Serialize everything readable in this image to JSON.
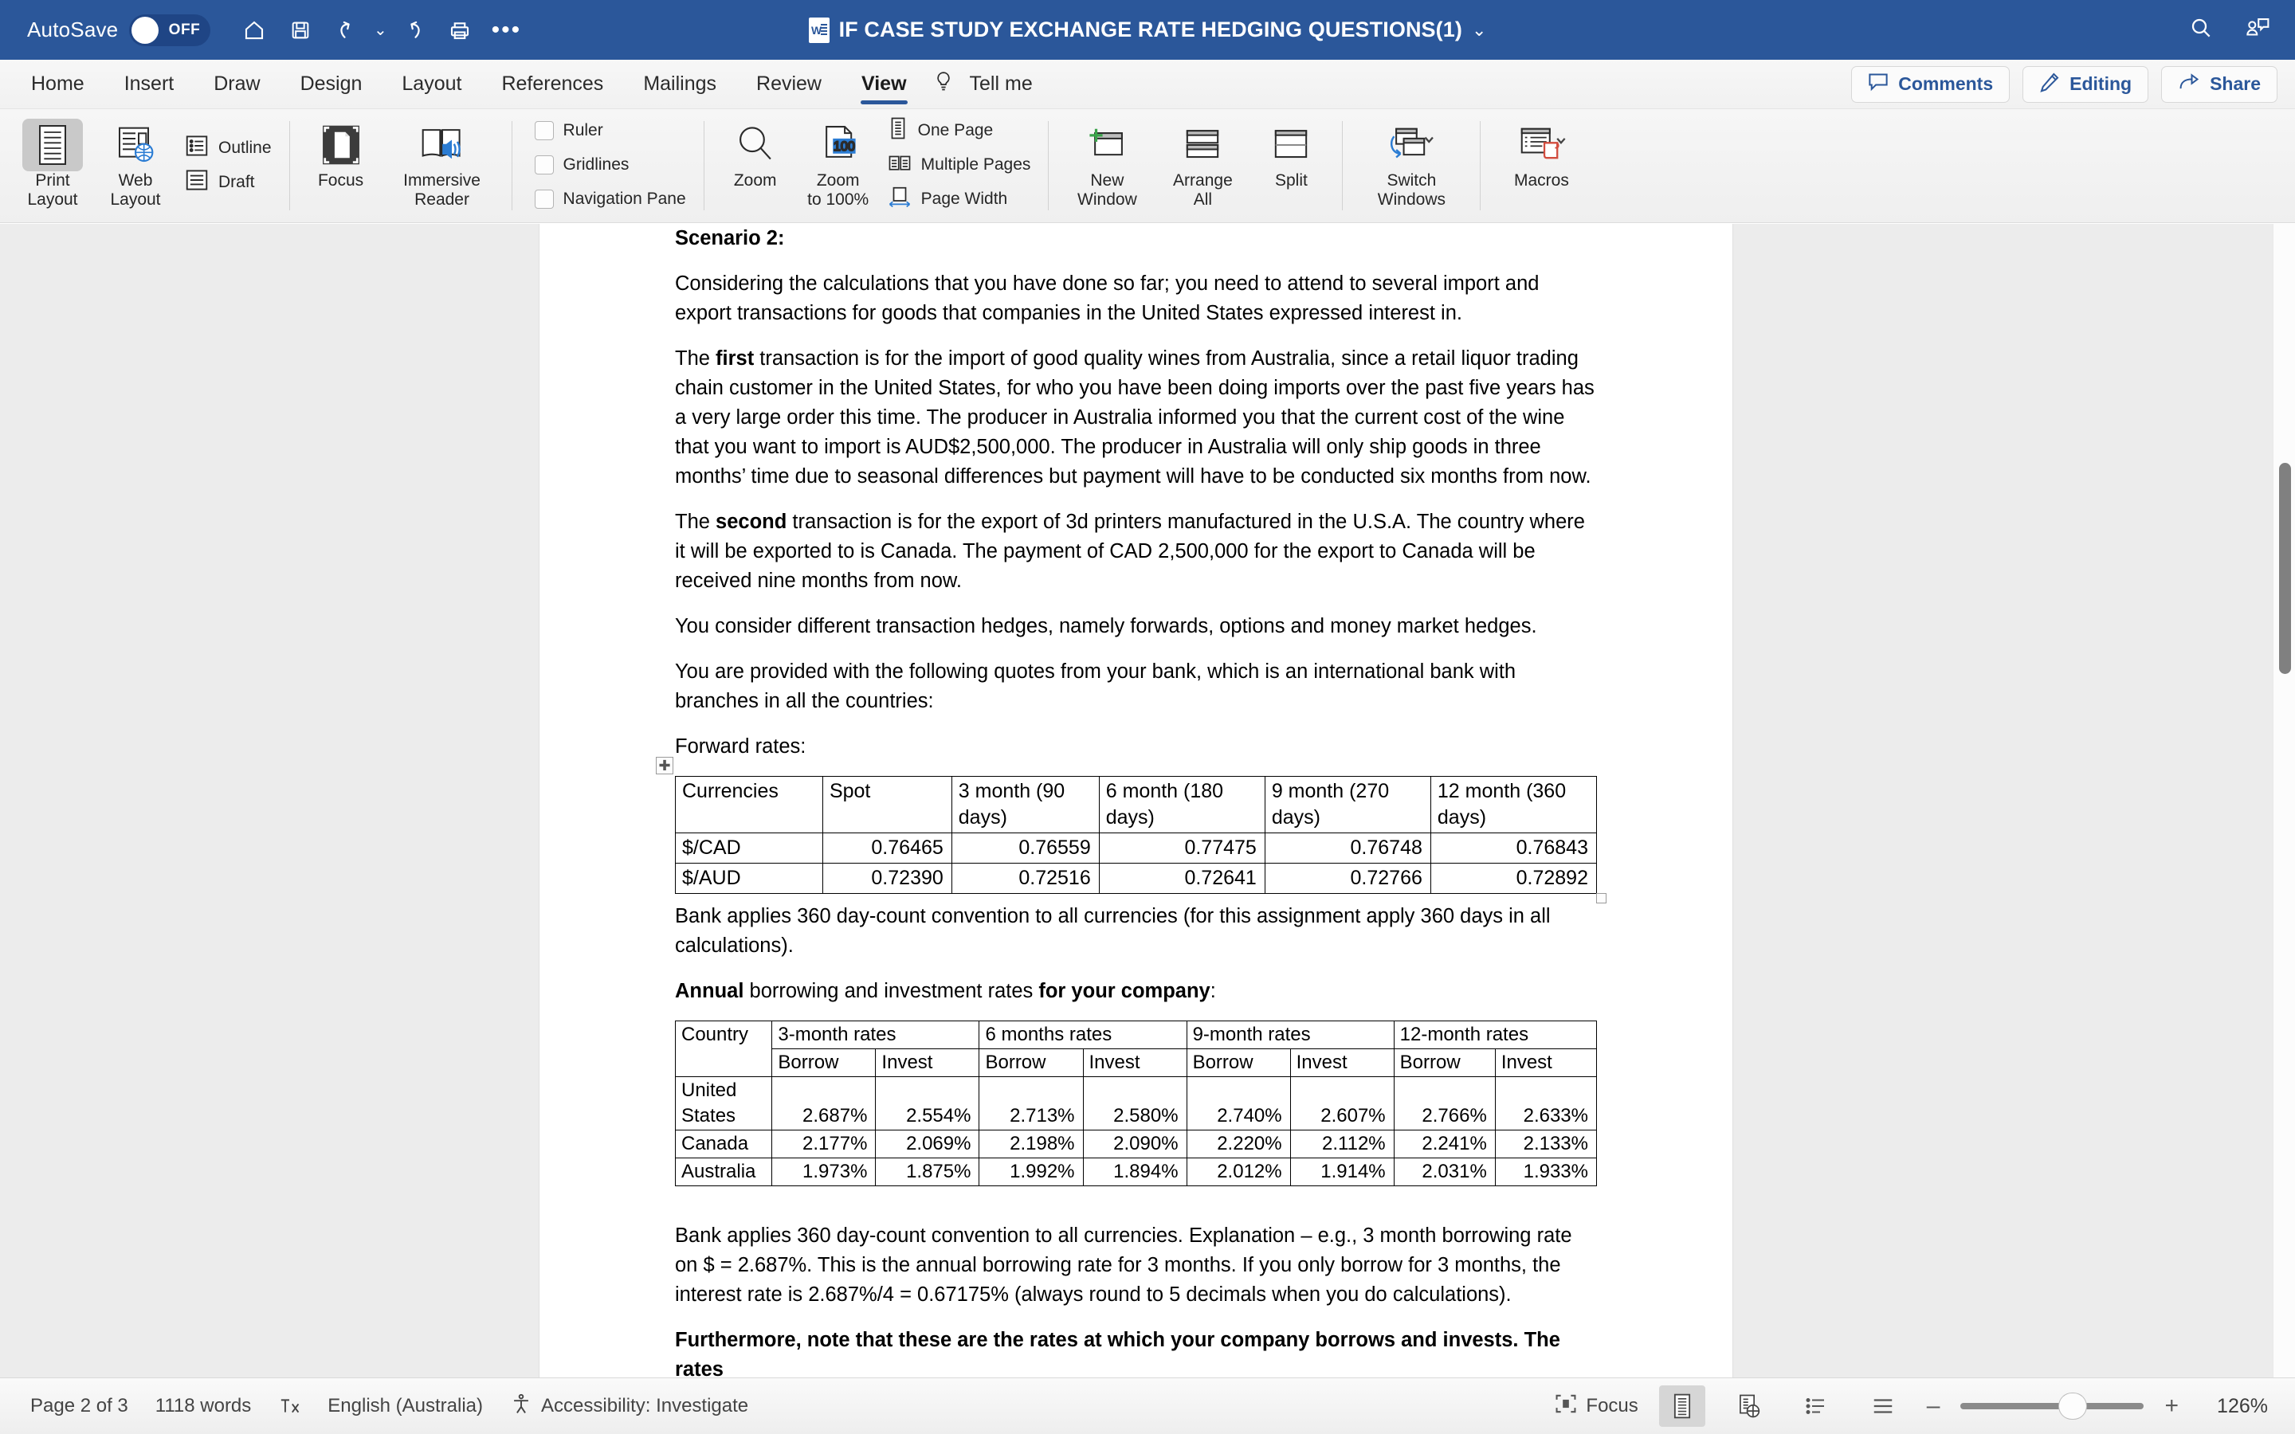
{
  "titlebar": {
    "autosave_label": "AutoSave",
    "autosave_state": "OFF",
    "doc_title": "IF CASE STUDY EXCHANGE RATE HEDGING QUESTIONS(1)",
    "word_badge_letter": "W",
    "title_caret": "⌄",
    "quick_access": [
      {
        "name": "home-icon",
        "label": "Home"
      },
      {
        "name": "save-icon",
        "label": "Save"
      },
      {
        "name": "undo-icon",
        "label": "Undo"
      },
      {
        "name": "undo-dropdown-caret",
        "label": "⌄"
      },
      {
        "name": "redo-icon",
        "label": "Redo"
      },
      {
        "name": "print-icon",
        "label": "Print"
      },
      {
        "name": "more-options-icon",
        "label": "•••"
      }
    ],
    "right_icons": [
      {
        "name": "search-icon",
        "label": "Search"
      },
      {
        "name": "account-comment-icon",
        "label": "Account"
      }
    ]
  },
  "ribbon_tabs": {
    "tabs": [
      {
        "label": "Home",
        "active": false
      },
      {
        "label": "Insert",
        "active": false
      },
      {
        "label": "Draw",
        "active": false
      },
      {
        "label": "Design",
        "active": false
      },
      {
        "label": "Layout",
        "active": false
      },
      {
        "label": "References",
        "active": false
      },
      {
        "label": "Mailings",
        "active": false
      },
      {
        "label": "Review",
        "active": false
      },
      {
        "label": "View",
        "active": true
      }
    ],
    "tell_me": "Tell me",
    "comments": "Comments",
    "editing": "Editing",
    "share": "Share",
    "accent": "#2b579a"
  },
  "ribbon": {
    "views": {
      "print_layout": "Print\nLayout",
      "print_layout_line1": "Print",
      "print_layout_line2": "Layout",
      "web_layout_line1": "Web",
      "web_layout_line2": "Layout",
      "outline": "Outline",
      "draft": "Draft"
    },
    "immersive": {
      "focus": "Focus",
      "immersive_line1": "Immersive",
      "immersive_line2": "Reader"
    },
    "show": {
      "ruler": "Ruler",
      "gridlines": "Gridlines",
      "navigation_pane": "Navigation Pane"
    },
    "zoom_group": {
      "zoom": "Zoom",
      "zoom_100_line1": "Zoom",
      "zoom_100_line2": "to 100%",
      "zoom_icon_value": "100",
      "one_page": "One Page",
      "multiple_pages": "Multiple Pages",
      "page_width": "Page Width"
    },
    "window": {
      "new_window_line1": "New",
      "new_window_line2": "Window",
      "arrange_all_line1": "Arrange",
      "arrange_all_line2": "All",
      "split": "Split",
      "switch_windows_line1": "Switch",
      "switch_windows_line2": "Windows",
      "macros": "Macros"
    }
  },
  "document": {
    "heading": "Scenario 2:",
    "p1": "Considering the calculations that you have done so far; you need to attend to several import and export transactions for goods that companies in the United States expressed interest in.",
    "p2_a": "The ",
    "p2_b": "first",
    "p2_c": " transaction is for the import of good quality wines from Australia, since a retail liquor trading chain customer in the United States, for who you have been doing imports over the past five years has a very large order this time. The producer in Australia informed you that the current cost of the wine that you want to import is AUD$2,500,000. The producer in Australia will only ship goods in three months’ time due to seasonal differences but payment will have to be conducted six months from now.",
    "p3_a": "The ",
    "p3_b": "second",
    "p3_c": " transaction is for the export of 3d printers manufactured in the U.S.A. The country where it will be exported to is Canada. The payment of CAD 2,500,000 for the export to Canada will be received nine months from now.",
    "p4": "You consider different transaction hedges, namely forwards, options and money market hedges.",
    "p5": "You are provided with the following quotes from your bank, which is an international bank with branches in all the countries:",
    "forward_label": "Forward rates:",
    "forward_table": {
      "headers": [
        "Currencies",
        "Spot",
        "3 month (90 days)",
        "6 month (180 days)",
        "9 month (270 days)",
        "12 month (360 days)"
      ],
      "rows": [
        [
          "$/CAD",
          "0.76465",
          "0.76559",
          "0.77475",
          "0.76748",
          "0.76843"
        ],
        [
          "$/AUD",
          "0.72390",
          "0.72516",
          "0.72641",
          "0.72766",
          "0.72892"
        ]
      ]
    },
    "p6": "Bank applies 360 day-count convention to all currencies (for this assignment apply 360 days in all calculations).",
    "p7_a": "Annual",
    "p7_b": " borrowing and investment rates ",
    "p7_c": "for your company",
    "p7_d": ":",
    "rates_table": {
      "corner": "Country",
      "group_headers": [
        "3-month rates",
        "6 months rates",
        "9-month rates",
        "12-month rates"
      ],
      "sub_headers": [
        "Borrow",
        "Invest",
        "Borrow",
        "Invest",
        "Borrow",
        "Invest",
        "Borrow",
        "Invest"
      ],
      "rows": [
        {
          "country": "United States",
          "country_line1": "United",
          "country_line2": "States",
          "values": [
            "2.687%",
            "2.554%",
            "2.713%",
            "2.580%",
            "2.740%",
            "2.607%",
            "2.766%",
            "2.633%"
          ]
        },
        {
          "country": "Canada",
          "country_line1": "Canada",
          "country_line2": "",
          "values": [
            "2.177%",
            "2.069%",
            "2.198%",
            "2.090%",
            "2.220%",
            "2.112%",
            "2.241%",
            "2.133%"
          ]
        },
        {
          "country": "Australia",
          "country_line1": "Australia",
          "country_line2": "",
          "values": [
            "1.973%",
            "1.875%",
            "1.992%",
            "1.894%",
            "2.012%",
            "1.914%",
            "2.031%",
            "1.933%"
          ]
        }
      ]
    },
    "p8": "Bank applies 360 day-count convention to all currencies. Explanation – e.g., 3 month borrowing rate on $ = 2.687%. This is the annual borrowing rate for 3 months. If you only borrow for 3 months, the interest rate is 2.687%/4 = 0.67175% (always round to 5 decimals when you do calculations).",
    "p9_bold": "Furthermore, note that these are the rates at which your company borrows and invests. The rates"
  },
  "statusbar": {
    "page": "Page 2 of 3",
    "words": "1118 words",
    "proofing_icon": "proofing-errors-icon",
    "language": "English (Australia)",
    "accessibility": "Accessibility: Investigate",
    "focus": "Focus",
    "zoom_value": "126%",
    "zoom_minus": "–",
    "zoom_plus": "+"
  }
}
